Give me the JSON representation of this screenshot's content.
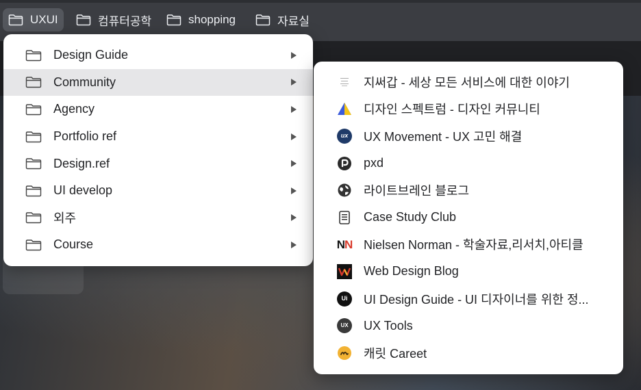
{
  "bookmark_bar": {
    "items": [
      {
        "label": "UXUI",
        "icon": "folder-icon",
        "active": true
      },
      {
        "label": "컴퓨터공학",
        "icon": "folder-icon"
      },
      {
        "label": "shopping",
        "icon": "folder-icon"
      },
      {
        "label": "자료실",
        "icon": "folder-icon"
      }
    ]
  },
  "folder_menu": {
    "items": [
      {
        "label": "Design Guide",
        "icon": "folder-icon",
        "has_submenu": true
      },
      {
        "label": "Community",
        "icon": "folder-icon",
        "has_submenu": true,
        "highlighted": true
      },
      {
        "label": "Agency",
        "icon": "folder-icon",
        "has_submenu": true
      },
      {
        "label": "Portfolio ref",
        "icon": "folder-icon",
        "has_submenu": true
      },
      {
        "label": "Design.ref",
        "icon": "folder-icon",
        "has_submenu": true
      },
      {
        "label": "UI develop",
        "icon": "folder-icon",
        "has_submenu": true
      },
      {
        "label": "외주",
        "icon": "folder-icon",
        "has_submenu": true
      },
      {
        "label": "Course",
        "icon": "folder-icon",
        "has_submenu": true
      }
    ]
  },
  "community_menu": {
    "items": [
      {
        "label": "지써갑 - 세상 모든 서비스에 대한 이야기",
        "icon": "text-logo-icon"
      },
      {
        "label": "디자인 스펙트럼 - 디자인 커뮤니티",
        "icon": "triangle-logo-icon"
      },
      {
        "label": "UX Movement - UX 고민 해결",
        "icon": "ux-circle-icon",
        "icon_text": "ux"
      },
      {
        "label": "pxd",
        "icon": "pxd-logo-icon"
      },
      {
        "label": "라이트브레인 블로그",
        "icon": "globe-icon"
      },
      {
        "label": "Case Study Club",
        "icon": "document-icon"
      },
      {
        "label": "Nielsen Norman - 학술자료,리서치,아티클",
        "icon": "nn-logo-icon",
        "icon_text_1": "N",
        "icon_text_2": "N"
      },
      {
        "label": "Web Design Blog",
        "icon": "w-logo-icon"
      },
      {
        "label": "UI Design Guide - UI 디자이너를 위한 정...",
        "icon": "ui-circle-icon",
        "icon_text": "Ui"
      },
      {
        "label": "UX Tools",
        "icon": "ux-tools-icon",
        "icon_text": "UX"
      },
      {
        "label": "캐릿 Careet",
        "icon": "careet-logo-icon"
      }
    ]
  },
  "colors": {
    "bar_bg": "#3b3d42",
    "menu_bg": "#ffffff",
    "highlight": "#e6e6e8",
    "spectrum_blue": "#3b5bdb",
    "spectrum_yellow": "#f5c518",
    "nn_red": "#d93a2b",
    "careet_yellow": "#f2b233",
    "ux_movement_navy": "#1f3a68"
  }
}
